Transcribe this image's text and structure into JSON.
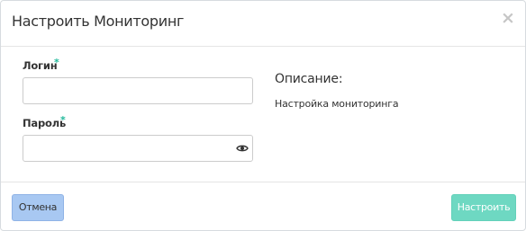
{
  "dialog": {
    "title": "Настроить Мониторинг",
    "close_glyph": "×"
  },
  "form": {
    "login": {
      "label": "Логин",
      "required_mark": "*",
      "value": ""
    },
    "password": {
      "label": "Пароль",
      "required_mark": "*",
      "value": "",
      "toggle_icon": "eye-icon"
    }
  },
  "description": {
    "heading": "Описание:",
    "text": "Настройка мониторинга"
  },
  "footer": {
    "cancel_label": "Отмена",
    "submit_label": "Настроить"
  },
  "colors": {
    "accent": "#20b89a",
    "submit_bg": "#6ed8c2",
    "cancel_bg": "#a8c8f2"
  }
}
